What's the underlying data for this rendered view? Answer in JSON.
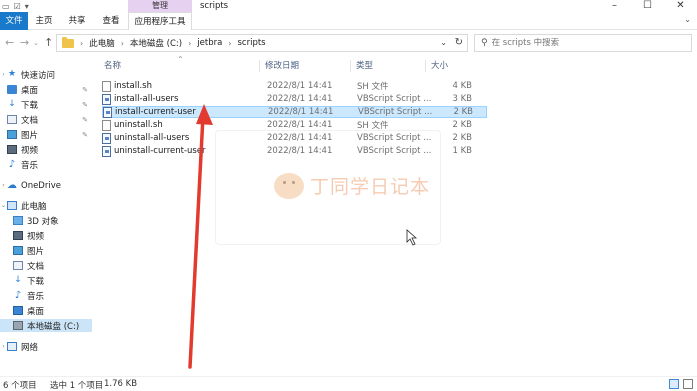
{
  "window": {
    "title": "scripts",
    "context_group": "管理"
  },
  "ribbon": {
    "tabs": [
      "文件",
      "主页",
      "共享",
      "查看",
      "应用程序工具"
    ]
  },
  "address": {
    "crumbs": [
      "此电脑",
      "本地磁盘 (C:)",
      "jetbra",
      "scripts"
    ]
  },
  "search": {
    "placeholder": "在 scripts 中搜索"
  },
  "sidebar": {
    "items": [
      {
        "label": "快速访问"
      },
      {
        "label": "桌面"
      },
      {
        "label": "下载"
      },
      {
        "label": "文档"
      },
      {
        "label": "图片"
      },
      {
        "label": "视频"
      },
      {
        "label": "音乐"
      },
      {
        "label": "OneDrive"
      },
      {
        "label": "此电脑"
      },
      {
        "label": "3D 对象"
      },
      {
        "label": "视频"
      },
      {
        "label": "图片"
      },
      {
        "label": "文档"
      },
      {
        "label": "下载"
      },
      {
        "label": "音乐"
      },
      {
        "label": "桌面"
      },
      {
        "label": "本地磁盘 (C:)"
      },
      {
        "label": "网络"
      }
    ]
  },
  "columns": {
    "name": "名称",
    "date": "修改日期",
    "type": "类型",
    "size": "大小"
  },
  "files": [
    {
      "name": "install.sh",
      "date": "2022/8/1 14:41",
      "type": "SH 文件",
      "size": "4 KB"
    },
    {
      "name": "install-all-users",
      "date": "2022/8/1 14:41",
      "type": "VBScript Script ...",
      "size": "3 KB"
    },
    {
      "name": "install-current-user",
      "date": "2022/8/1 14:41",
      "type": "VBScript Script ...",
      "size": "2 KB"
    },
    {
      "name": "uninstall.sh",
      "date": "2022/8/1 14:41",
      "type": "SH 文件",
      "size": "2 KB"
    },
    {
      "name": "uninstall-all-users",
      "date": "2022/8/1 14:41",
      "type": "VBScript Script ...",
      "size": "2 KB"
    },
    {
      "name": "uninstall-current-user",
      "date": "2022/8/1 14:41",
      "type": "VBScript Script ...",
      "size": "1 KB"
    }
  ],
  "watermark": {
    "text": "丁同学日记本"
  },
  "status": {
    "count": "6 个项目",
    "selected": "选中 1 个项目",
    "size": "1.76 KB"
  },
  "colors": {
    "accent": "#1979ca",
    "selection": "#cce8ff",
    "arrow": "#e23a2e"
  }
}
